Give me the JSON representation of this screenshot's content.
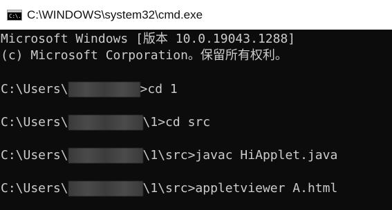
{
  "window": {
    "title": "C:\\WINDOWS\\system32\\cmd.exe",
    "icon_text": "C:\\."
  },
  "console": {
    "header_line1": "Microsoft Windows [版本 10.0.19043.1288]",
    "header_line2": "(c) Microsoft Corporation。保留所有权利。",
    "lines": [
      {
        "prefix": "C:\\Users\\",
        "suffix": ">cd 1"
      },
      {
        "prefix": "C:\\Users\\",
        "suffix": "\\1>cd src"
      },
      {
        "prefix": "C:\\Users\\",
        "suffix": "\\1\\src>javac HiApplet.java"
      },
      {
        "prefix": "C:\\Users\\",
        "suffix": "\\1\\src>appletviewer A.html"
      }
    ]
  },
  "colors": {
    "background": "#0c0c0c",
    "foreground": "#cccccc",
    "titlebar": "#ffffff"
  }
}
